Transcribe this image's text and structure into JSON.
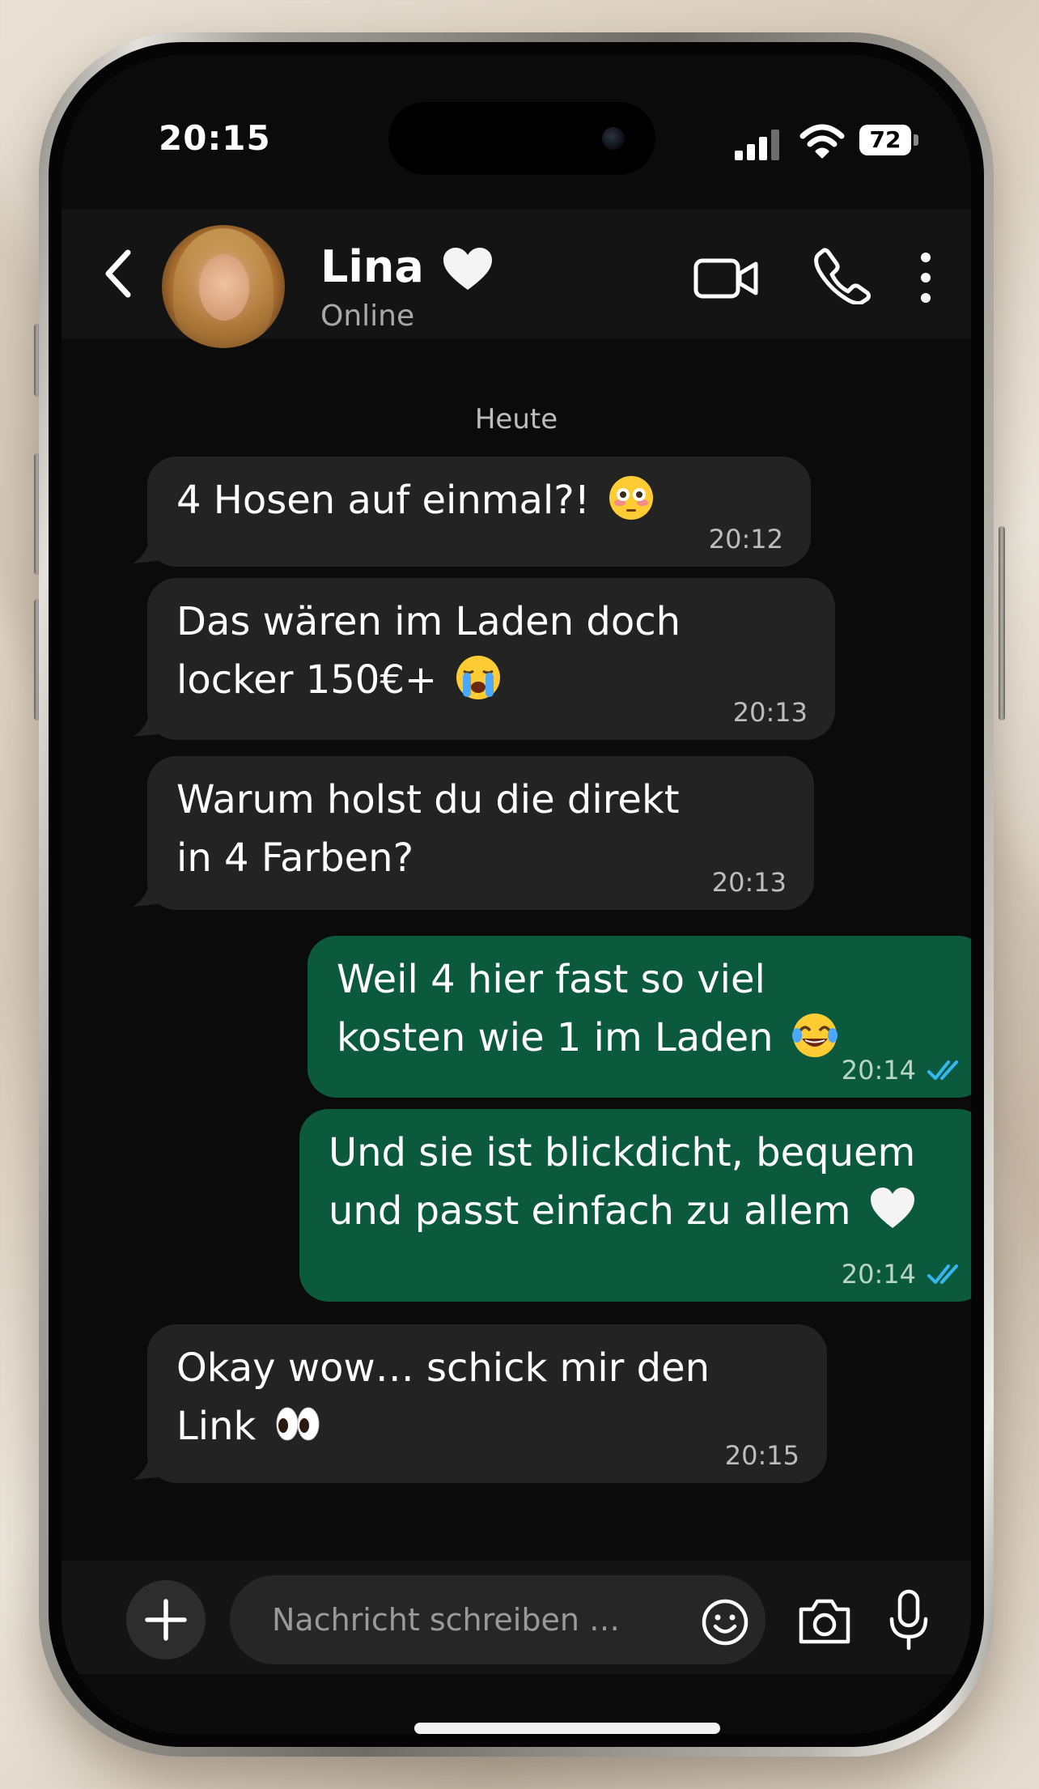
{
  "status_bar": {
    "time": "20:15",
    "battery_level": "72"
  },
  "header": {
    "contact_name": "Lina",
    "contact_status": "Online"
  },
  "chat": {
    "date_label": "Heute",
    "messages": [
      {
        "direction": "in",
        "text": "4 Hosen auf einmal?!",
        "emoji": "flushed-face-emoji",
        "time": "20:12"
      },
      {
        "direction": "in",
        "text": "Das wären im Laden doch\nlocker 150€+",
        "emoji": "loudly-crying-face-emoji",
        "time": "20:13"
      },
      {
        "direction": "in",
        "text": "Warum holst du die direkt\nin 4 Farben?",
        "time": "20:13"
      },
      {
        "direction": "out",
        "text": "Weil 4 hier fast so viel\nkosten wie 1 im Laden",
        "emoji": "tears-of-joy-emoji",
        "time": "20:14",
        "read": true
      },
      {
        "direction": "out",
        "text": "Und sie ist blickdicht, bequem\nund passt einfach zu allem",
        "emoji": "white-heart-emoji",
        "time": "20:14",
        "read": true
      },
      {
        "direction": "in",
        "text": "Okay wow… schick mir den\nLink",
        "emoji": "eyes-emoji",
        "time": "20:15"
      }
    ]
  },
  "composer": {
    "placeholder": "Nachricht schreiben …"
  },
  "colors": {
    "incoming_bubble": "#232323",
    "outgoing_bubble": "#0c5a3e",
    "read_ticks": "#34b7f1",
    "screen_background": "#0b0b0b"
  }
}
